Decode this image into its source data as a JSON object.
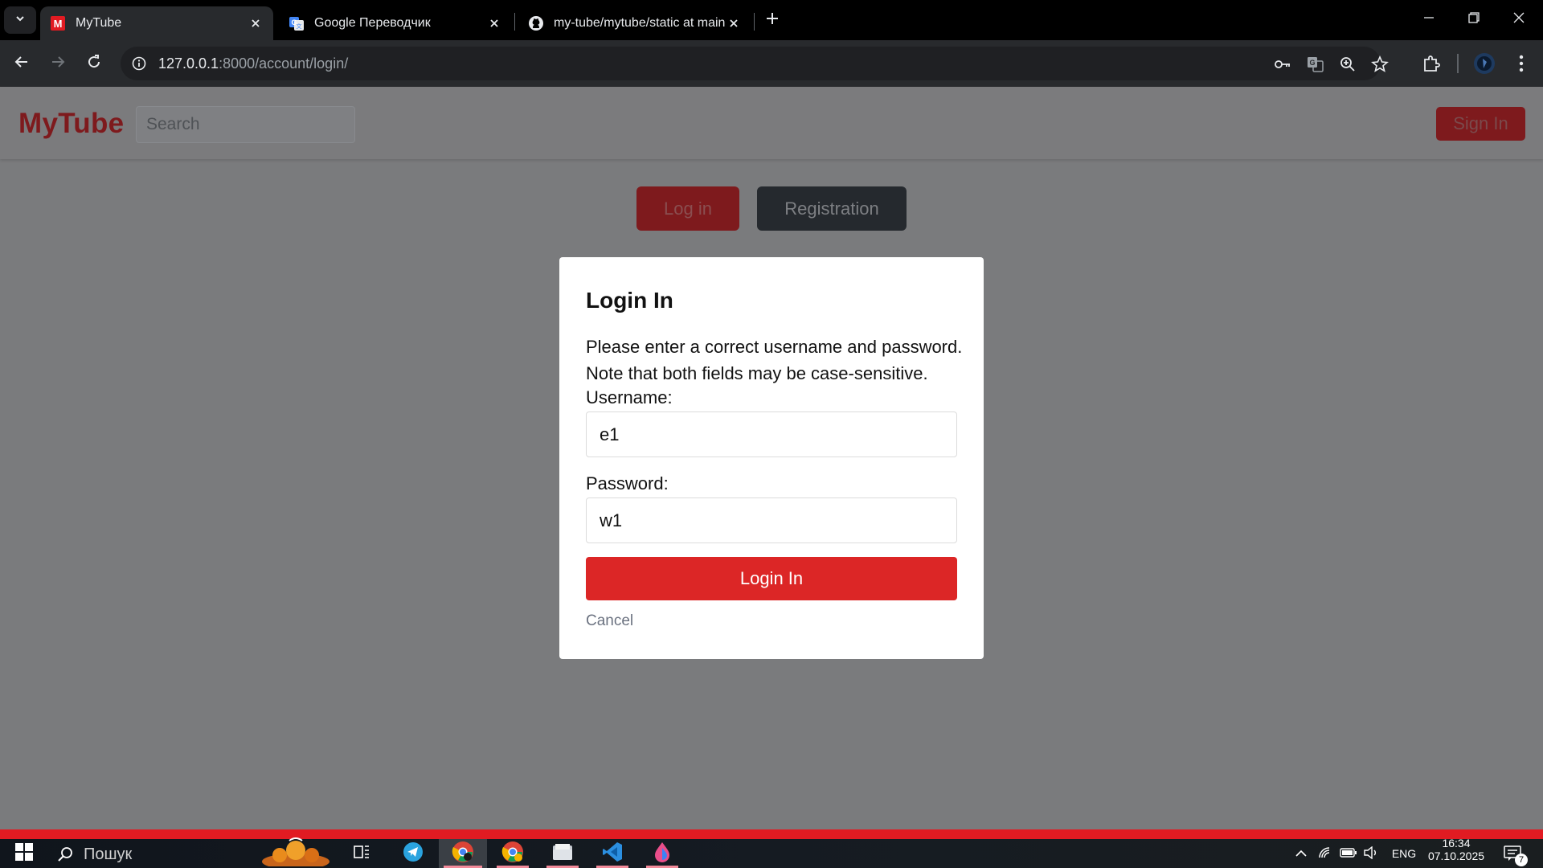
{
  "browser": {
    "tabs": [
      {
        "title": "MyTube",
        "favicon": "mytube-favicon",
        "active": true
      },
      {
        "title": "Google Переводчик",
        "favicon": "google-translate-favicon",
        "active": false
      },
      {
        "title": "my-tube/mytube/static at main",
        "favicon": "github-favicon",
        "active": false
      }
    ],
    "url_host": "127.0.0.1",
    "url_rest": ":8000/account/login/"
  },
  "header": {
    "logo": "MyTube",
    "search_placeholder": "Search",
    "signin_label": "Sign In"
  },
  "switcher": {
    "login_label": "Log in",
    "register_label": "Registration"
  },
  "modal": {
    "title": "Login In",
    "error": "Please enter a correct username and password. Note that both fields may be case-sensitive.",
    "username_label": "Username:",
    "username_value": "e1",
    "password_label": "Password:",
    "password_value": "w1",
    "submit_label": "Login In",
    "cancel_label": "Cancel"
  },
  "taskbar": {
    "search_label": "Пошук",
    "language": "ENG",
    "time": "16:34",
    "date": "07.10.2025",
    "notifications": "7"
  },
  "colors": {
    "brand": "#7e1a1d",
    "submit": "#dc2626",
    "accent_line": "#e11b22"
  }
}
